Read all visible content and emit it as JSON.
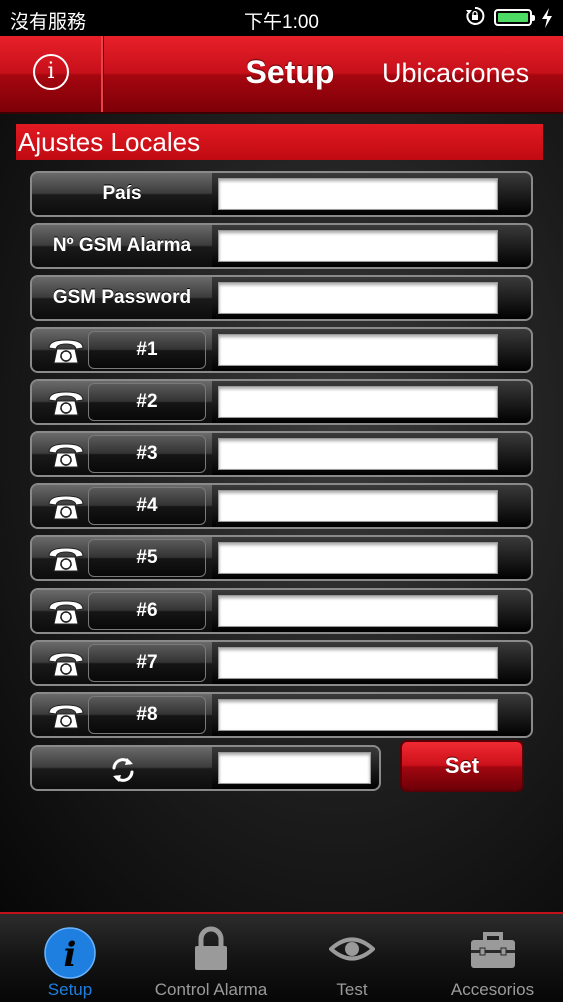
{
  "status_bar": {
    "carrier": "沒有服務",
    "time": "下午1:00"
  },
  "nav": {
    "title": "Setup",
    "right_button": "Ubicaciones",
    "info_symbol": "i"
  },
  "section": {
    "title": "Ajustes Locales"
  },
  "fields": [
    {
      "label": "País",
      "value": ""
    },
    {
      "label": "Nº GSM Alarma",
      "value": ""
    },
    {
      "label": "GSM Password",
      "value": ""
    }
  ],
  "phones": [
    {
      "label": "#1",
      "value": ""
    },
    {
      "label": "#2",
      "value": ""
    },
    {
      "label": "#3",
      "value": ""
    },
    {
      "label": "#4",
      "value": ""
    },
    {
      "label": "#5",
      "value": ""
    },
    {
      "label": "#6",
      "value": ""
    },
    {
      "label": "#7",
      "value": ""
    },
    {
      "label": "#8",
      "value": ""
    }
  ],
  "refresh": {
    "value": ""
  },
  "set_button": "Set",
  "tabs": [
    {
      "label": "Setup",
      "icon": "info-icon",
      "active": true
    },
    {
      "label": "Control Alarma",
      "icon": "lock-icon",
      "active": false
    },
    {
      "label": "Test",
      "icon": "eye-icon",
      "active": false
    },
    {
      "label": "Accesorios",
      "icon": "toolbox-icon",
      "active": false
    }
  ],
  "colors": {
    "accent_red": "#c7101a",
    "tab_active": "#1e7fe0",
    "battery": "#4cd964"
  }
}
